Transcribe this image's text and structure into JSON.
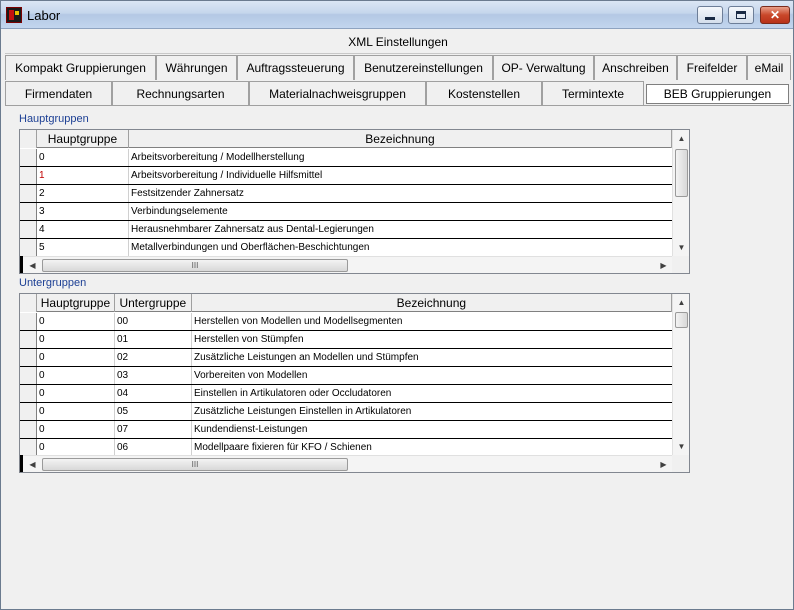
{
  "window": {
    "title": "Labor",
    "icons": {
      "app": "app-icon",
      "minimize": "minimize-icon",
      "maximize": "maximize-icon",
      "close": "close-icon"
    }
  },
  "header": {
    "title": "XML Einstellungen"
  },
  "tabs_row1": [
    "Kompakt Gruppierungen",
    "Währungen",
    "Auftragssteuerung",
    "Benutzereinstellungen",
    "OP- Verwaltung",
    "Anschreiben",
    "Freifelder",
    "eMail"
  ],
  "tabs_row2": [
    "Firmendaten",
    "Rechnungsarten",
    "Materialnachweisgruppen",
    "Kostenstellen",
    "Termintexte",
    "BEB Gruppierungen"
  ],
  "active_tab": "BEB Gruppierungen",
  "hauptgruppen": {
    "label": "Hauptgruppen",
    "columns": [
      "Hauptgruppe",
      "Bezeichnung"
    ],
    "rows": [
      [
        "0",
        "Arbeitsvorbereitung / Modellherstellung"
      ],
      [
        "1",
        "Arbeitsvorbereitung / Individuelle Hilfsmittel"
      ],
      [
        "2",
        "Festsitzender Zahnersatz"
      ],
      [
        "3",
        "Verbindungselemente"
      ],
      [
        "4",
        "Herausnehmbarer Zahnersatz aus Dental-Legierungen"
      ],
      [
        "5",
        "Metallverbindungen und Oberflächen-Beschichtungen"
      ]
    ]
  },
  "untergruppen": {
    "label": "Untergruppen",
    "columns": [
      "Hauptgruppe",
      "Untergruppe",
      "Bezeichnung"
    ],
    "rows": [
      [
        "0",
        "00",
        "Herstellen von Modellen und Modellsegmenten"
      ],
      [
        "0",
        "01",
        "Herstellen von Stümpfen"
      ],
      [
        "0",
        "02",
        "Zusätzliche Leistungen an Modellen und Stümpfen"
      ],
      [
        "0",
        "03",
        "Vorbereiten von Modellen"
      ],
      [
        "0",
        "04",
        "Einstellen in Artikulatoren oder Occludatoren"
      ],
      [
        "0",
        "05",
        "Zusätzliche Leistungen Einstellen in Artikulatoren"
      ],
      [
        "0",
        "07",
        "Kundendienst-Leistungen"
      ],
      [
        "0",
        "06",
        "Modellpaare fixieren für KFO / Schienen"
      ]
    ]
  },
  "scrollbar": {
    "thumb_grip": "III"
  }
}
